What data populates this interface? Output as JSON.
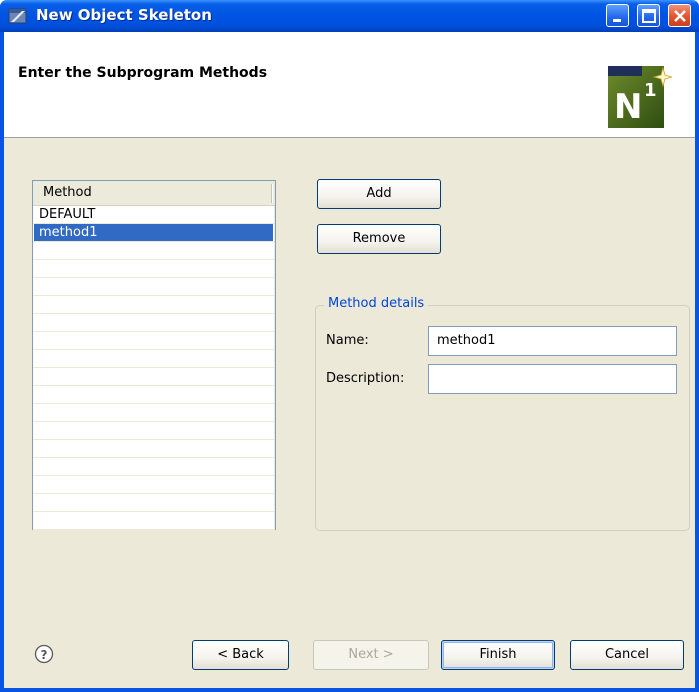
{
  "window": {
    "title": "New Object Skeleton"
  },
  "banner": {
    "title": "Enter the Subprogram Methods",
    "logo_icon": "n1-logo-icon"
  },
  "methods_table": {
    "column_header": "Method",
    "rows": [
      "DEFAULT",
      "method1",
      "",
      "",
      "",
      "",
      "",
      "",
      "",
      "",
      "",
      "",
      "",
      "",
      "",
      "",
      "",
      ""
    ],
    "selected_index": 1
  },
  "actions": {
    "add_label": "Add",
    "remove_label": "Remove"
  },
  "details": {
    "legend": "Method details",
    "name_label": "Name:",
    "name_value": "method1",
    "description_label": "Description:",
    "description_value": ""
  },
  "footer": {
    "help_icon": "help-icon",
    "back_label": "< Back",
    "next_label": "Next >",
    "finish_label": "Finish",
    "cancel_label": "Cancel"
  },
  "colors": {
    "titlebar": "#0054e3",
    "selection": "#316ac5",
    "legend_text": "#0046d5",
    "dialog_bg": "#ece9d8"
  }
}
